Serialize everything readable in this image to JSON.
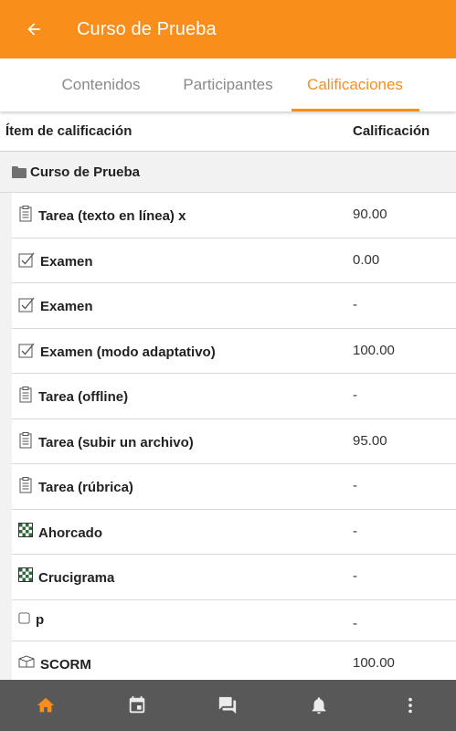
{
  "header": {
    "title": "Curso de Prueba",
    "accent_color": "#f98e1b",
    "back_icon": "arrow-left-icon"
  },
  "tabs": [
    {
      "label": "Contenidos",
      "active": false
    },
    {
      "label": "Participantes",
      "active": false
    },
    {
      "label": "Calificaciones",
      "active": true
    }
  ],
  "table": {
    "col_item": "Ítem de calificación",
    "col_grade": "Calificación",
    "category": {
      "icon": "folder-icon",
      "name": "Curso de Prueba"
    },
    "rows": [
      {
        "icon": "assignment-icon",
        "name": "Tarea (texto en línea) x",
        "grade": "90.00"
      },
      {
        "icon": "quiz-icon",
        "name": "Examen",
        "grade": "0.00"
      },
      {
        "icon": "quiz-icon",
        "name": "Examen",
        "grade": "-"
      },
      {
        "icon": "quiz-icon",
        "name": "Examen (modo adaptativo)",
        "grade": "100.00"
      },
      {
        "icon": "assignment-icon",
        "name": "Tarea (offline)",
        "grade": "-"
      },
      {
        "icon": "assignment-icon",
        "name": "Tarea (subir un archivo)",
        "grade": "95.00"
      },
      {
        "icon": "assignment-icon",
        "name": "Tarea (rúbrica)",
        "grade": "-"
      },
      {
        "icon": "game-icon",
        "name": "Ahorcado",
        "grade": "-"
      },
      {
        "icon": "game-icon",
        "name": "Crucigrama",
        "grade": "-"
      },
      {
        "icon": "checkbox-icon",
        "name": "p",
        "grade": "-"
      },
      {
        "icon": "scorm-icon",
        "name": "SCORM",
        "grade": "100.00"
      }
    ]
  },
  "bottom_nav": [
    {
      "icon": "home-icon",
      "active": true
    },
    {
      "icon": "calendar-icon",
      "active": false
    },
    {
      "icon": "messages-icon",
      "active": false
    },
    {
      "icon": "notifications-icon",
      "active": false
    },
    {
      "icon": "more-vertical-icon",
      "active": false
    }
  ]
}
